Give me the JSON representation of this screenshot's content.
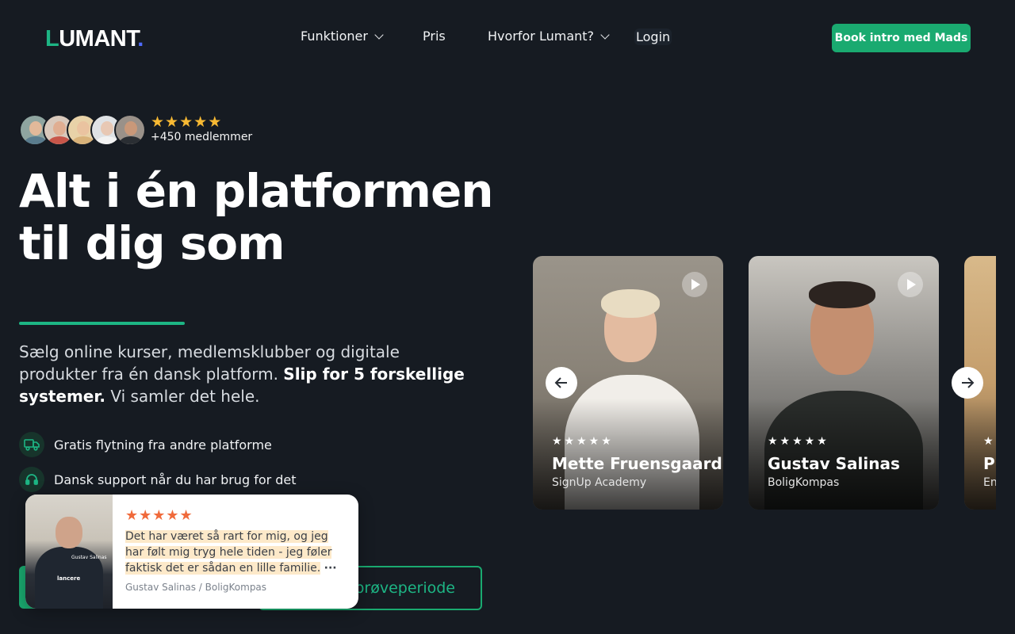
{
  "header": {
    "logo": {
      "first": "L",
      "rest": "UMANT",
      "dot": "."
    },
    "nav": [
      {
        "label": "Funktioner",
        "dropdown": true
      },
      {
        "label": "Pris",
        "dropdown": false
      },
      {
        "label": "Hvorfor Lumant?",
        "dropdown": true
      },
      {
        "label": "Login",
        "dropdown": false
      }
    ],
    "cta": "Book intro med Mads"
  },
  "social_proof": {
    "members": "+450 medlemmer",
    "stars": 5
  },
  "hero": {
    "title_line1": "Alt i én platformen",
    "title_line2": "til dig som",
    "lead_start": "Sælg online kurser, medlemsklubber og digitale produkter fra én dansk platform. ",
    "lead_bold": "Slip for 5 forskellige systemer.",
    "lead_end": " Vi samler det hele."
  },
  "features": [
    {
      "icon": "truck-icon",
      "text": "Gratis flytning fra andre platforme"
    },
    {
      "icon": "headset-icon",
      "text": "Dansk support når du har brug for det"
    }
  ],
  "buttons": {
    "outline": "s prøveperiode"
  },
  "review": {
    "stars": 5,
    "quote": "Det har været så rart for mig, og jeg har følt mig tryg hele tiden - jeg føler faktisk det er sådan en lille familie.",
    "more": "···",
    "author": "Gustav Salinas / BoligKompas",
    "thumb_caption_small": "Gustav Salinas",
    "thumb_caption_large": "lancere"
  },
  "testimonials": [
    {
      "name": "Mette Fruensgaard",
      "company": "SignUp Academy",
      "stars": "★★★★★"
    },
    {
      "name": "Gustav Salinas",
      "company": "BoligKompas",
      "stars": "★★★★★"
    },
    {
      "name": "Pi",
      "company": "En",
      "stars": "★"
    }
  ],
  "colors": {
    "background": "#161b22",
    "accent": "#1aaa70",
    "star": "#f7b933",
    "review_star": "#f06a3b"
  }
}
